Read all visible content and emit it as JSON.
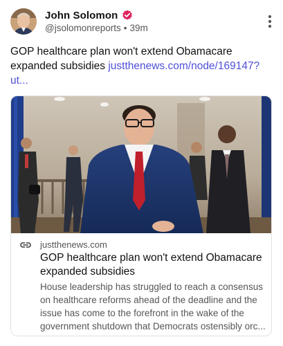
{
  "author": {
    "name": "John Solomon",
    "handle": "@jsolomonreports",
    "separator": "•",
    "time": "39m",
    "verified_icon": "verified-badge-icon",
    "verified_color": "#e0245e"
  },
  "post": {
    "text": "GOP healthcare plan won't extend Obamacare expanded subsidies ",
    "link_text": "justthenews.com/node/169147?ut..."
  },
  "card": {
    "domain": "justthenews.com",
    "title": "GOP healthcare plan won't extend Obamacare expanded subsidies",
    "description": "House leadership has struggled to reach a consensus on healthcare reforms ahead of the deadline and the issue has come to the forefront in the wake of the government shutdown that Democrats ostensibly orc..."
  },
  "colors": {
    "link": "#4f4fd9",
    "text": "#111111",
    "muted": "#555555"
  },
  "icons": {
    "more": "more-vertical-icon",
    "link": "link-icon"
  }
}
